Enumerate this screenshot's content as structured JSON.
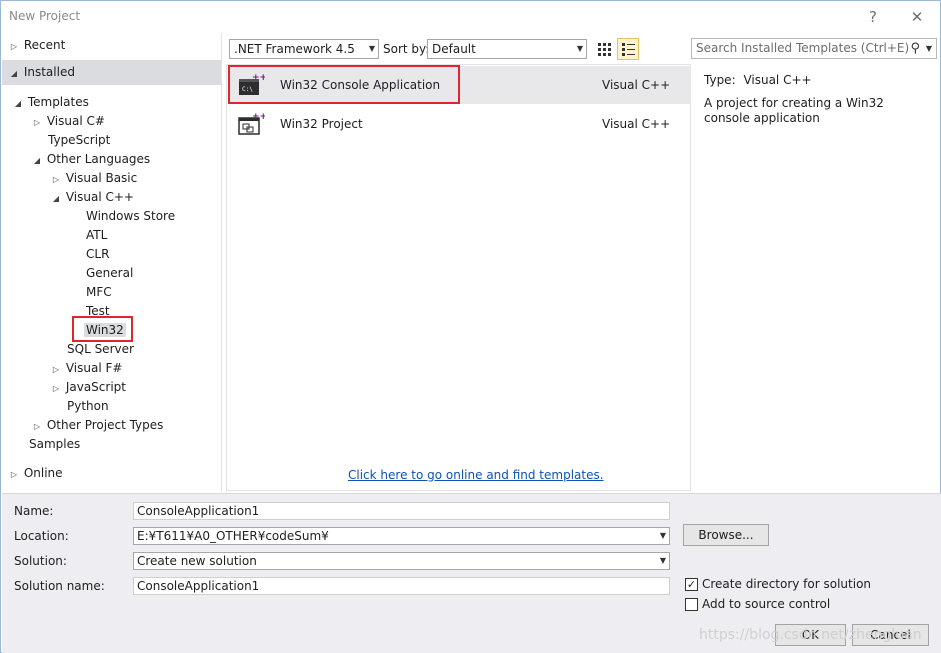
{
  "window": {
    "title": "New Project",
    "help": "?",
    "close": "✕"
  },
  "tree": {
    "recent": "Recent",
    "installed": "Installed",
    "templates": "Templates",
    "visual_csharp": "Visual C#",
    "typescript": "TypeScript",
    "other_languages": "Other Languages",
    "visual_basic": "Visual Basic",
    "visual_cpp": "Visual C++",
    "windows_store": "Windows Store",
    "atl": "ATL",
    "clr": "CLR",
    "general": "General",
    "mfc": "MFC",
    "test": "Test",
    "win32": "Win32",
    "sql_server": "SQL Server",
    "visual_fsharp": "Visual F#",
    "javascript": "JavaScript",
    "python": "Python",
    "other_project_types": "Other Project Types",
    "samples": "Samples",
    "online": "Online"
  },
  "toolbar": {
    "framework": ".NET Framework 4.5",
    "sort_by_label": "Sort by:",
    "sort_value": "Default"
  },
  "search": {
    "placeholder": "Search Installed Templates (Ctrl+E)"
  },
  "templates": [
    {
      "name": "Win32 Console Application",
      "language": "Visual C++"
    },
    {
      "name": "Win32 Project",
      "language": "Visual C++"
    }
  ],
  "online_link": "Click here to go online and find templates.",
  "details": {
    "type_label": "Type:",
    "type_value": "Visual C++",
    "description": "A project for creating a Win32 console application"
  },
  "form": {
    "name_label": "Name:",
    "name_value": "ConsoleApplication1",
    "location_label": "Location:",
    "location_value": "E:¥T611¥A0_OTHER¥codeSum¥",
    "solution_label": "Solution:",
    "solution_value": "Create new solution",
    "solution_name_label": "Solution name:",
    "solution_name_value": "ConsoleApplication1",
    "browse": "Browse...",
    "create_dir": "Create directory for solution",
    "add_source": "Add to source control",
    "ok": "OK",
    "cancel": "Cancel"
  },
  "watermark": "https://blog.csdn.net/zhengluan",
  "colors": {
    "selection": "#dadcdf",
    "highlight": "#e0262d",
    "link": "#0e52b5",
    "accent_purple": "#68217a"
  }
}
